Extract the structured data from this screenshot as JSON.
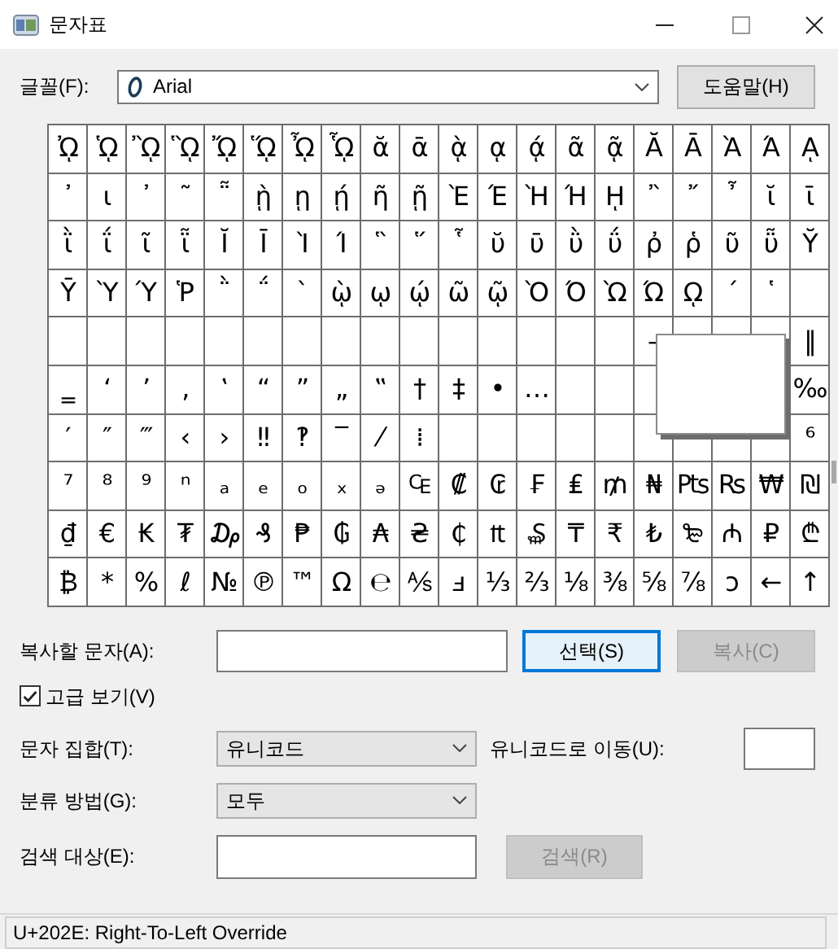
{
  "window": {
    "title": "문자표"
  },
  "font": {
    "label": "글꼴(F):",
    "value": "Arial"
  },
  "help_button": "도움말(H)",
  "grid": {
    "rows": [
      [
        "ᾨ",
        "ᾩ",
        "ᾪ",
        "ᾫ",
        "ᾬ",
        "ᾭ",
        "ᾮ",
        "ᾯ",
        "ᾰ",
        "ᾱ",
        "ᾲ",
        "ᾳ",
        "ᾴ",
        "ᾶ",
        "ᾷ",
        "Ᾰ",
        "Ᾱ",
        "Ὰ",
        "Ά",
        "ᾼ"
      ],
      [
        "᾽",
        "ι",
        "᾿",
        "῀",
        "῁",
        "ῂ",
        "ῃ",
        "ῄ",
        "ῆ",
        "ῇ",
        "Ὲ",
        "Έ",
        "Ὴ",
        "Ή",
        "ῌ",
        "῍",
        "῎",
        "῏",
        "ῐ",
        "ῑ"
      ],
      [
        "ῒ",
        "ΐ",
        "ῖ",
        "ῗ",
        "Ῐ",
        "Ῑ",
        "Ὶ",
        "Ί",
        "῝",
        "῞",
        "῟",
        "ῠ",
        "ῡ",
        "ῢ",
        "ΰ",
        "ῤ",
        "ῥ",
        "ῦ",
        "ῧ",
        "Ῠ"
      ],
      [
        "Ῡ",
        "Ὺ",
        "Ύ",
        "Ῥ",
        "῭",
        "΅",
        "`",
        "ῲ",
        "ῳ",
        "ῴ",
        "ῶ",
        "ῷ",
        "Ὸ",
        "Ό",
        "Ὼ",
        "Ώ",
        "ῼ",
        "´",
        "῾",
        null
      ],
      [
        null,
        null,
        null,
        null,
        null,
        null,
        null,
        null,
        null,
        null,
        null,
        null,
        null,
        null,
        null,
        "–",
        null,
        null,
        null,
        "‖"
      ],
      [
        "‗",
        "‘",
        "’",
        "‚",
        "‛",
        "“",
        "”",
        "„",
        "‟",
        "†",
        "‡",
        "•",
        "…",
        null,
        null,
        null,
        null,
        null,
        null,
        "‰"
      ],
      [
        "′",
        "″",
        "‴",
        "‹",
        "›",
        "‼",
        "‽",
        "‾",
        "⁄",
        "⁞",
        null,
        null,
        null,
        null,
        null,
        null,
        null,
        null,
        null,
        "⁶"
      ],
      [
        "⁷",
        "⁸",
        "⁹",
        "ⁿ",
        "ₐ",
        "ₑ",
        "ₒ",
        "ₓ",
        "ₔ",
        "₠",
        "₡",
        "₢",
        "₣",
        "₤",
        "₥",
        "₦",
        "₧",
        "₨",
        "₩",
        "₪"
      ],
      [
        "₫",
        "€",
        "₭",
        "₮",
        "₯",
        "₰",
        "₱",
        "₲",
        "₳",
        "₴",
        "₵",
        "₶",
        "₷",
        "₸",
        "₹",
        "₺",
        "₻",
        "₼",
        "₽",
        "₾"
      ],
      [
        "₿",
        "*",
        "%",
        "ℓ",
        "№",
        "℗",
        "™",
        "Ω",
        "℮",
        "⅍",
        "ⅎ",
        "⅓",
        "⅔",
        "⅛",
        "⅜",
        "⅝",
        "⅞",
        "ↄ",
        "←",
        "↑"
      ]
    ]
  },
  "magnifier": {
    "shown": true
  },
  "copy": {
    "label": "복사할 문자(A):",
    "select_button": {
      "label": "선택(S)",
      "focused": true
    },
    "copy_button": {
      "label": "복사(C)",
      "disabled": true
    }
  },
  "advanced_view": {
    "label": "고급 보기(V)",
    "checked": true
  },
  "charset": {
    "label": "문자 집합(T):",
    "value": "유니코드"
  },
  "goto_unicode": {
    "label": "유니코드로 이동(U):"
  },
  "group_by": {
    "label": "분류 방법(G):",
    "value": "모두"
  },
  "search": {
    "label": "검색 대상(E):",
    "button": {
      "label": "검색(R)",
      "disabled": true
    }
  },
  "status_bar": "U+202E: Right-To-Left Override"
}
